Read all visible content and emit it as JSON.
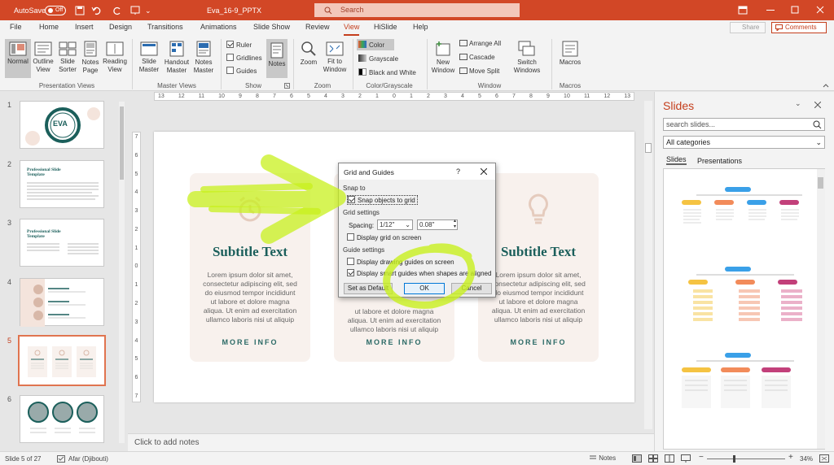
{
  "titlebar": {
    "autosave_label": "AutoSave",
    "autosave_state": "Off",
    "doc_title": "Eva_16-9_PPTX",
    "search_placeholder": "Search"
  },
  "tabs": [
    "File",
    "Home",
    "Insert",
    "Design",
    "Transitions",
    "Animations",
    "Slide Show",
    "Review",
    "View",
    "HiSlide",
    "Help"
  ],
  "share_label": "Share",
  "comments_label": "Comments",
  "ribbon": {
    "presentation_views": {
      "label": "Presentation Views",
      "buttons": [
        "Normal",
        "Outline View",
        "Slide Sorter",
        "Notes Page",
        "Reading View"
      ]
    },
    "master_views": {
      "label": "Master Views",
      "buttons": [
        "Slide Master",
        "Handout Master",
        "Notes Master"
      ]
    },
    "show": {
      "label": "Show",
      "checks": [
        {
          "label": "Ruler",
          "checked": true
        },
        {
          "label": "Gridlines",
          "checked": false
        },
        {
          "label": "Guides",
          "checked": false
        }
      ],
      "notes": "Notes"
    },
    "zoom": {
      "label": "Zoom",
      "buttons": [
        "Zoom",
        "Fit to Window"
      ]
    },
    "color": {
      "label": "Color/Grayscale",
      "options": [
        "Color",
        "Grayscale",
        "Black and White"
      ]
    },
    "window": {
      "label": "Window",
      "new_window": "New Window",
      "small": [
        "Arrange All",
        "Cascade",
        "Move Split"
      ],
      "switch": "Switch Windows"
    },
    "macros": {
      "label": "Macros",
      "button": "Macros"
    }
  },
  "slides": {
    "numbers": [
      "1",
      "2",
      "3",
      "4",
      "5",
      "6"
    ],
    "selected": 5,
    "thumb1_logo": "EVA",
    "thumb_title": "Professional Slide Template"
  },
  "ruler": {
    "h_ticks": [
      "13",
      "12",
      "11",
      "10",
      "9",
      "8",
      "7",
      "6",
      "5",
      "4",
      "3",
      "2",
      "1",
      "0",
      "1",
      "2",
      "3",
      "4",
      "5",
      "6",
      "7",
      "8",
      "9",
      "10",
      "11",
      "12",
      "13"
    ],
    "v_ticks": [
      "7",
      "6",
      "5",
      "4",
      "3",
      "2",
      "1",
      "0",
      "1",
      "2",
      "3",
      "4",
      "5",
      "6",
      "7"
    ]
  },
  "cards": [
    {
      "title": "Subtitle Text",
      "body": [
        "Lorem ipsum dolor sit amet,",
        "consectetur adipiscing elit, sed",
        "do eiusmod tempor incididunt",
        "ut labore et dolore magna",
        "aliqua. Ut enim ad exercitation",
        "ullamco laboris nisi ut aliquip"
      ],
      "more": "MORE INFO"
    },
    {
      "title": "",
      "body": [
        "aliqua. Ut enim ad exercitation",
        "ullamco laboris nisi ut aliquip"
      ],
      "more": "MORE INFO"
    },
    {
      "title": "Subtitle Text",
      "body": [
        "Lorem ipsum dolor sit amet,",
        "consectetur adipiscing elit, sed",
        "do eiusmod tempor incididunt",
        "ut labore et dolore magna",
        "aliqua. Ut enim ad exercitation",
        "ullamco laboris nisi ut aliquip"
      ],
      "more": "MORE INFO"
    }
  ],
  "middle_fragments": [
    "ut labore et dolore magna"
  ],
  "dialog": {
    "title": "Grid and Guides",
    "help": "?",
    "snap_to": "Snap to",
    "snap_objects": "Snap objects to grid",
    "grid_settings": "Grid settings",
    "spacing_label": "Spacing:",
    "spacing_value": "1/12\"",
    "spacing_number": "0.08\"",
    "display_grid": "Display grid on screen",
    "guide_settings": "Guide settings",
    "display_guides": "Display drawing guides on screen",
    "smart_guides": "Display smart guides when shapes are aligned",
    "set_default": "Set as Default",
    "ok": "OK",
    "cancel": "Cancel"
  },
  "pane": {
    "title": "Slides",
    "search_placeholder": "search slides...",
    "category": "All categories",
    "tabs": [
      "Slides",
      "Presentations"
    ]
  },
  "notes_placeholder": "Click to add notes",
  "status": {
    "slide_info": "Slide 5 of 27",
    "language": "Afar (Djibouti)",
    "notes": "Notes",
    "zoom": "34%"
  },
  "colors": {
    "accent": "#d24726",
    "teal": "#1b5f5b",
    "highlight": "#c8f01e"
  }
}
